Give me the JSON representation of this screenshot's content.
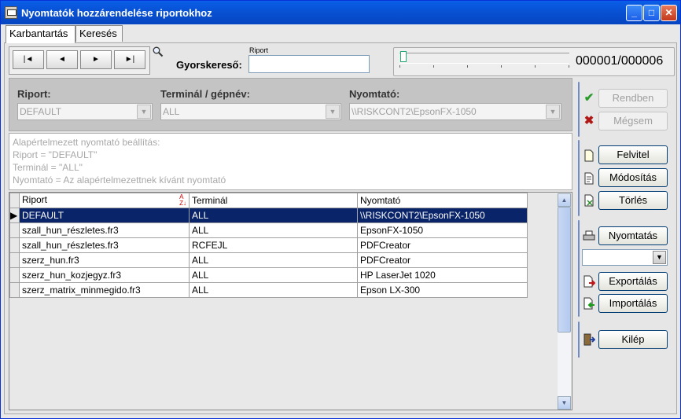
{
  "window": {
    "title": "Nyomtatók hozzárendelése riportokhoz"
  },
  "tabs": [
    {
      "label": "Karbantartás"
    },
    {
      "label": "Keresés"
    }
  ],
  "nav": {
    "first": "|◄",
    "prev": "◄",
    "next": "►",
    "last": "►|"
  },
  "search": {
    "label": "Gyorskereső:",
    "field_caption": "Riport",
    "value": ""
  },
  "record_counter": "000001/000006",
  "filters": {
    "riport": {
      "label": "Riport:",
      "value": "DEFAULT"
    },
    "terminal": {
      "label": "Terminál / gépnév:",
      "value": "ALL"
    },
    "nyomtato": {
      "label": "Nyomtató:",
      "value": "\\\\RISKCONT2\\EpsonFX-1050"
    }
  },
  "info_lines": [
    "Alapértelmezett nyomtató beállítás:",
    "Riport = \"DEFAULT\"",
    "Terminál = \"ALL\"",
    "Nyomtató = Az alapértelmezettnek kívánt nyomtató"
  ],
  "table": {
    "columns": [
      "Riport",
      "Terminál",
      "Nyomtató"
    ],
    "rows": [
      [
        "DEFAULT",
        "ALL",
        "\\\\RISKCONT2\\EpsonFX-1050"
      ],
      [
        "szall_hun_részletes.fr3",
        "ALL",
        "EpsonFX-1050"
      ],
      [
        "szall_hun_részletes.fr3",
        "RCFEJL",
        "PDFCreator"
      ],
      [
        "szerz_hun.fr3",
        "ALL",
        "PDFCreator"
      ],
      [
        "szerz_hun_kozjegyz.fr3",
        "ALL",
        "HP LaserJet 1020"
      ],
      [
        "szerz_matrix_minmegido.fr3",
        "ALL",
        "Epson LX-300"
      ]
    ]
  },
  "actions": {
    "rendben": "Rendben",
    "megsem": "Mégsem",
    "felvitel": "Felvitel",
    "modositas": "Módosítás",
    "torles": "Törlés",
    "nyomtatas": "Nyomtatás",
    "exportalas": "Exportálás",
    "importalas": "Importálás",
    "kilep": "Kilép"
  },
  "icons": {
    "ok": "check-icon",
    "cancel": "x-icon",
    "new": "new-document-icon",
    "edit": "edit-document-icon",
    "delete": "delete-icon",
    "print": "printer-icon",
    "export": "export-icon",
    "import": "import-icon",
    "exit": "exit-door-icon"
  },
  "colors": {
    "selection": "#0a246a",
    "titlebar": "#0853d6",
    "ok_green": "#2a9a2a",
    "cancel_red": "#b01818"
  }
}
